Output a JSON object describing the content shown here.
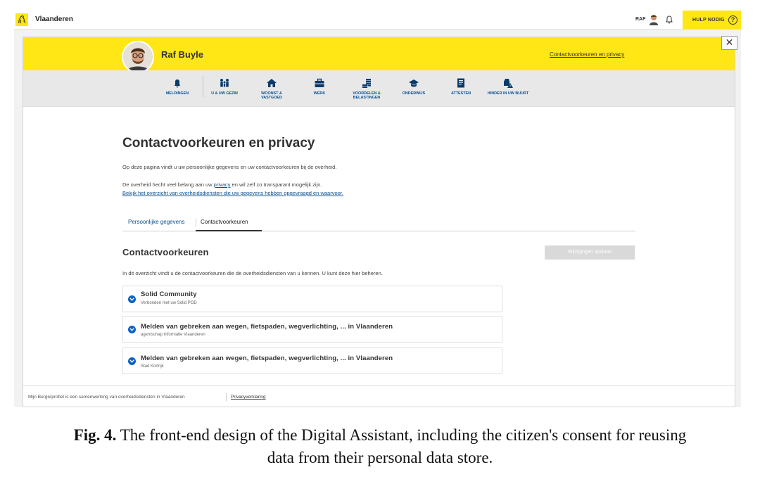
{
  "topbar": {
    "brand": "Vlaanderen",
    "user_short": "RAF",
    "help_label": "HULP NODIG",
    "help_icon": "question-circle-icon"
  },
  "header": {
    "username": "Raf Buyle",
    "top_link": "Contactvoorkeuren en privacy",
    "close_icon": "close-icon",
    "accent_color": "#ffe615"
  },
  "nav": {
    "items": [
      {
        "label": "MELDINGEN",
        "icon": "bell-icon"
      },
      {
        "label": "U & UW GEZIN",
        "icon": "family-icon"
      },
      {
        "label": "WOONST & VASTGOED",
        "icon": "house-icon"
      },
      {
        "label": "WERK",
        "icon": "briefcase-icon"
      },
      {
        "label": "VOORDELEN & BELASTINGEN",
        "icon": "coins-icon"
      },
      {
        "label": "ONDERWIJS",
        "icon": "graduation-cap-icon"
      },
      {
        "label": "ATTESTEN",
        "icon": "certificate-icon"
      },
      {
        "label": "HINDER IN UW BUURT",
        "icon": "car-warning-icon"
      }
    ]
  },
  "page": {
    "title": "Contactvoorkeuren en privacy",
    "intro": "Op deze pagina vindt u uw persoonlijke gegevens en uw contactvoorkeuren bij de overheid.",
    "privacy_before": "De overheid hecht veel belang aan uw ",
    "privacy_link": "privacy",
    "privacy_after": " en wil zelf zo transparant mogelijk zijn.",
    "overview_link": "Bekijk het overzicht van overheidsdiensten die uw gegevens hebben opgevraagd en waarvoor."
  },
  "tabs": {
    "personal": "Persoonlijke gegevens",
    "contact": "Contactvoorkeuren",
    "active": "Contactvoorkeuren"
  },
  "section": {
    "title": "Contactvoorkeuren",
    "save_button": "Wijzigingen opslaan",
    "description": "In dit overzicht vindt u de contactvoorkeuren die de overheidsdiensten van u kennen. U kunt deze hier beheren.",
    "items": [
      {
        "title": "Solid Community",
        "subtitle": "Verbonden met uw Solid POD"
      },
      {
        "title": "Melden van gebreken aan wegen, fietspaden, wegverlichting, ... in Vlaanderen",
        "subtitle": "agentschap Informatie Vlaanderen"
      },
      {
        "title": "Melden van gebreken aan wegen, fietspaden, wegverlichting, ... in Vlaanderen",
        "subtitle": "Stad Kortrijk"
      }
    ]
  },
  "footer": {
    "text": "Mijn Burgerprofiel is een samenwerking van overheidsdiensten in Vlaanderen",
    "link": "Privacyverklaring"
  },
  "caption": {
    "label": "Fig. 4.",
    "text": " The front-end design of the Digital Assistant, including the citizen's consent for reusing",
    "text2": "data from their personal data store."
  }
}
